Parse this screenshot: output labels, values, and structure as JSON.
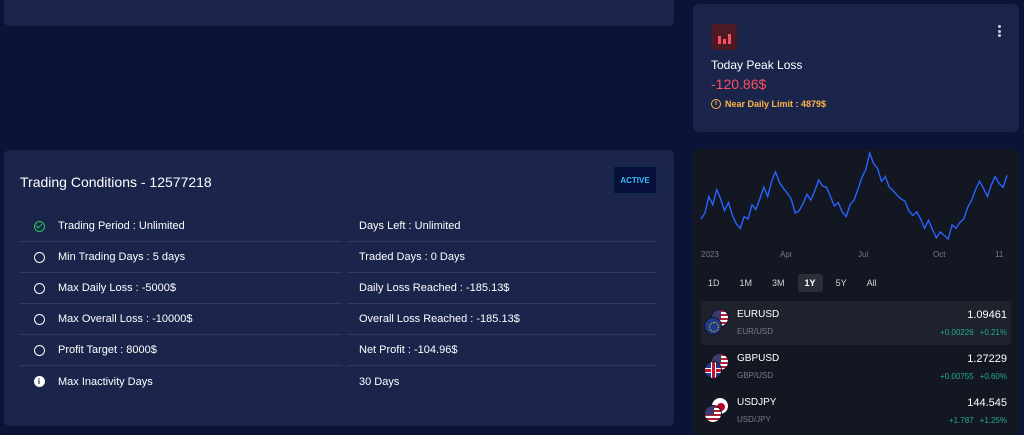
{
  "peak_card": {
    "title": "Today Peak Loss",
    "value": "-120.86$",
    "warning": "Near Daily Limit : 4879$",
    "warning_color": "#ffb547",
    "value_color": "#ff4d5e"
  },
  "trading_conditions": {
    "title": "Trading Conditions - 12577218",
    "status_badge": "ACTIVE",
    "left": [
      {
        "icon": "check-circle-icon",
        "text": "Trading Period : Unlimited"
      },
      {
        "icon": "circle-icon",
        "text": "Min Trading Days : 5 days"
      },
      {
        "icon": "circle-icon",
        "text": "Max Daily Loss : -5000$"
      },
      {
        "icon": "circle-icon",
        "text": "Max Overall Loss : -10000$"
      },
      {
        "icon": "circle-icon",
        "text": "Profit Target : 8000$"
      },
      {
        "icon": "info-icon",
        "text": "Max Inactivity Days"
      }
    ],
    "right": [
      {
        "text": "Days Left : Unlimited"
      },
      {
        "text": "Traded Days : 0 Days"
      },
      {
        "text": "Daily Loss Reached : -185.13$"
      },
      {
        "text": "Overall Loss Reached : -185.13$"
      },
      {
        "text": "Net Profit : -104.96$"
      },
      {
        "text": "30 Days"
      }
    ]
  },
  "chart_data": {
    "type": "line",
    "x_tick_labels": [
      "2023",
      "Apr",
      "Jul",
      "Oct",
      "11"
    ],
    "series": [
      {
        "color": "#2962ff",
        "values": [
          1.066,
          1.071,
          1.085,
          1.078,
          1.091,
          1.083,
          1.073,
          1.08,
          1.069,
          1.062,
          1.058,
          1.068,
          1.066,
          1.078,
          1.074,
          1.083,
          1.093,
          1.085,
          1.098,
          1.106,
          1.097,
          1.092,
          1.088,
          1.083,
          1.071,
          1.073,
          1.079,
          1.087,
          1.082,
          1.09,
          1.099,
          1.094,
          1.093,
          1.085,
          1.077,
          1.08,
          1.072,
          1.068,
          1.078,
          1.082,
          1.091,
          1.101,
          1.108,
          1.122,
          1.113,
          1.109,
          1.098,
          1.102,
          1.093,
          1.09,
          1.086,
          1.083,
          1.081,
          1.073,
          1.069,
          1.072,
          1.066,
          1.058,
          1.065,
          1.057,
          1.05,
          1.055,
          1.052,
          1.049,
          1.061,
          1.058,
          1.063,
          1.066,
          1.076,
          1.082,
          1.091,
          1.098,
          1.092,
          1.085,
          1.095,
          1.102,
          1.096,
          1.093,
          1.103
        ]
      }
    ]
  },
  "range_tabs": [
    "1D",
    "1M",
    "3M",
    "1Y",
    "5Y",
    "All"
  ],
  "range_selected": "1Y",
  "quotes": [
    {
      "symbol": "EURUSD",
      "description": "EUR/USD",
      "price": "1.09461",
      "change": "+0.00226",
      "change_pct": "+0.21%",
      "flags": [
        "us",
        "eu"
      ]
    },
    {
      "symbol": "GBPUSD",
      "description": "GBP/USD",
      "price": "1.27229",
      "change": "+0.00755",
      "change_pct": "+0.60%",
      "flags": [
        "us",
        "gb"
      ]
    },
    {
      "symbol": "USDJPY",
      "description": "USD/JPY",
      "price": "144.545",
      "change": "+1.787",
      "change_pct": "+1.25%",
      "flags": [
        "jp",
        "us"
      ]
    }
  ]
}
